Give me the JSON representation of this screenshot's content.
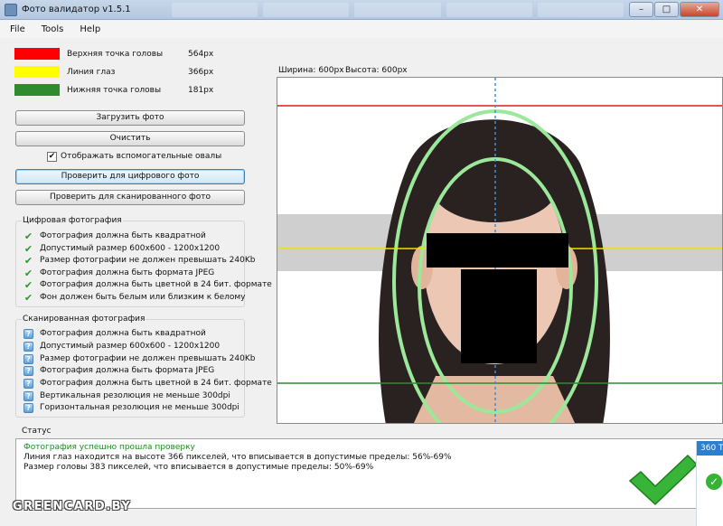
{
  "window": {
    "title": "Фото валидатор v1.5.1",
    "minimize_glyph": "–",
    "maximize_glyph": "□",
    "close_glyph": "✕"
  },
  "menu": {
    "items": [
      "File",
      "Tools",
      "Help"
    ]
  },
  "legend": [
    {
      "label": "Верхняя точка головы",
      "value": "564px",
      "color": "#ff0000"
    },
    {
      "label": "Линия глаз",
      "value": "366px",
      "color": "#ffff00"
    },
    {
      "label": "Нижняя точка головы",
      "value": "181px",
      "color": "#2e8b2e"
    }
  ],
  "buttons": {
    "load": "Загрузить фото",
    "clear": "Очистить",
    "check_digital": "Проверить для цифрового фото",
    "check_scanned": "Проверить для сканированного фото"
  },
  "checkbox": {
    "label": "Отображать вспомогательные овалы",
    "checked": true,
    "glyph": "✔"
  },
  "digital_group": {
    "title": "Цифровая фотография",
    "icon": "check-icon",
    "items": [
      "Фотография должна быть квадратной",
      "Допустимый размер 600x600 - 1200x1200",
      "Размер фотографии не должен превышать 240Kb",
      "Фотография должна быть формата JPEG",
      "Фотография должна быть цветной в 24 бит. формате",
      "Фон должен быть белым или близким к белому"
    ]
  },
  "scanned_group": {
    "title": "Сканированная фотография",
    "icon": "question-icon",
    "items": [
      "Фотография должна быть квадратной",
      "Допустимый размер 600x600 - 1200x1200",
      "Размер фотографии не должен превышать 240Kb",
      "Фотография должна быть формата JPEG",
      "Фотография должна быть цветной в 24 бит. формате",
      "Вертикальная резолюция не меньше 300dpi",
      "Горизонтальная резолюция не меньше 300dpi"
    ]
  },
  "photo": {
    "width_label": "Ширина: 600px",
    "height_label": "Высота: 600px"
  },
  "status": {
    "label": "Статус",
    "lines": [
      {
        "text": "Фотография успешно прошла проверку",
        "color": "#1e8c1e"
      },
      {
        "text": "Линия глаз находится на высоте 366 пикселей, что вписывается в допустимые пределы: 56%-69%",
        "color": "#111111"
      },
      {
        "text": "Размер головы 383 пикселей, что вписывается в допустимые пределы: 50%-69%",
        "color": "#111111"
      }
    ]
  },
  "overlay": {
    "watermark": "GREENCARD.BY",
    "popup_title": "360 T"
  },
  "colors": {
    "accent_green": "#3cb83c",
    "oval_green": "#9be89b"
  }
}
